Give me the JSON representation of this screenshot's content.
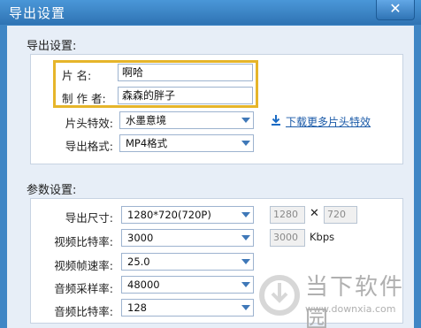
{
  "window": {
    "title": "导出设置",
    "close_glyph": "✕"
  },
  "export": {
    "section_title": "导出设置:",
    "name_label": "片    名:",
    "name_value": "啊哈",
    "author_label": "制 作 者:",
    "author_value": "森森的胖子",
    "intro_label": "片头特效:",
    "intro_value": "水墨意境",
    "download_link": "下载更多片头特效",
    "format_label": "导出格式:",
    "format_value": "MP4格式"
  },
  "params": {
    "section_title": "参数设置:",
    "size_label": "导出尺寸:",
    "size_value": "1280*720(720P)",
    "width": "1280",
    "times": "✕",
    "height": "720",
    "vbitrate_label": "视频比特率:",
    "vbitrate_value": "3000",
    "vbitrate_box": "3000",
    "vbitrate_unit": "Kbps",
    "framerate_label": "视频帧速率:",
    "framerate_value": "25.0",
    "samplerate_label": "音频采样率:",
    "samplerate_value": "48000",
    "abitrate_label": "音频比特率:",
    "abitrate_value": "128"
  },
  "watermark": {
    "text": "当下软件园",
    "url": "www.downxia.com"
  }
}
